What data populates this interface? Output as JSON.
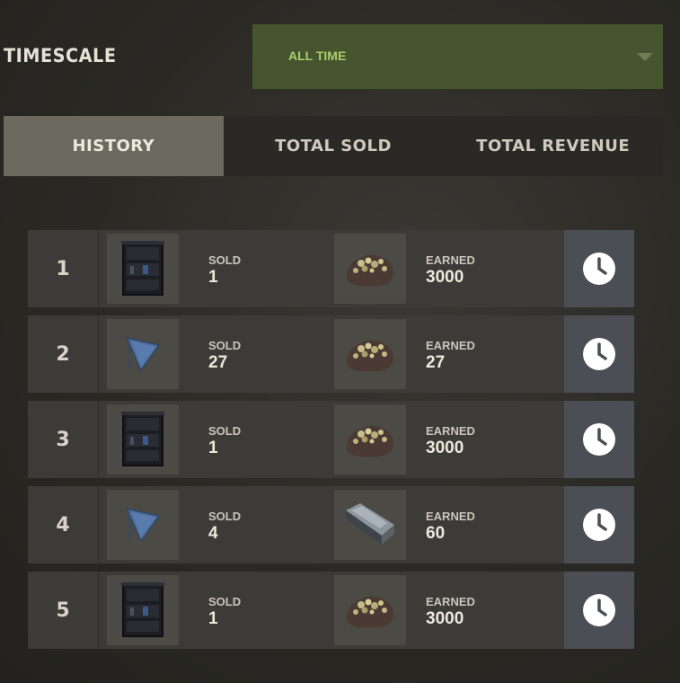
{
  "header": {
    "timescale_label": "TIMESCALE",
    "timescale_value": "ALL TIME",
    "accent_color": "#46542f"
  },
  "tabs": [
    {
      "label": "HISTORY",
      "active": true
    },
    {
      "label": "TOTAL SOLD",
      "active": false
    },
    {
      "label": "TOTAL REVENUE",
      "active": false
    }
  ],
  "rows": [
    {
      "rank": "1",
      "sold_item": "bookshelf-icon",
      "sold_label": "SOLD",
      "sold_value": "1",
      "earn_item": "metal-ore-icon",
      "earned_label": "EARNED",
      "earned_value": "3000",
      "action_icon": "clock-icon"
    },
    {
      "rank": "2",
      "sold_item": "flag-icon",
      "sold_label": "SOLD",
      "sold_value": "27",
      "earn_item": "metal-ore-icon",
      "earned_label": "EARNED",
      "earned_value": "27",
      "action_icon": "clock-icon"
    },
    {
      "rank": "3",
      "sold_item": "bookshelf-icon",
      "sold_label": "SOLD",
      "sold_value": "1",
      "earn_item": "metal-ore-icon",
      "earned_label": "EARNED",
      "earned_value": "3000",
      "action_icon": "clock-icon"
    },
    {
      "rank": "4",
      "sold_item": "flag-icon",
      "sold_label": "SOLD",
      "sold_value": "4",
      "earn_item": "metal-ingot-icon",
      "earned_label": "EARNED",
      "earned_value": "60",
      "action_icon": "clock-icon"
    },
    {
      "rank": "5",
      "sold_item": "bookshelf-icon",
      "sold_label": "SOLD",
      "sold_value": "1",
      "earn_item": "metal-ore-icon",
      "earned_label": "EARNED",
      "earned_value": "3000",
      "action_icon": "clock-icon"
    }
  ]
}
